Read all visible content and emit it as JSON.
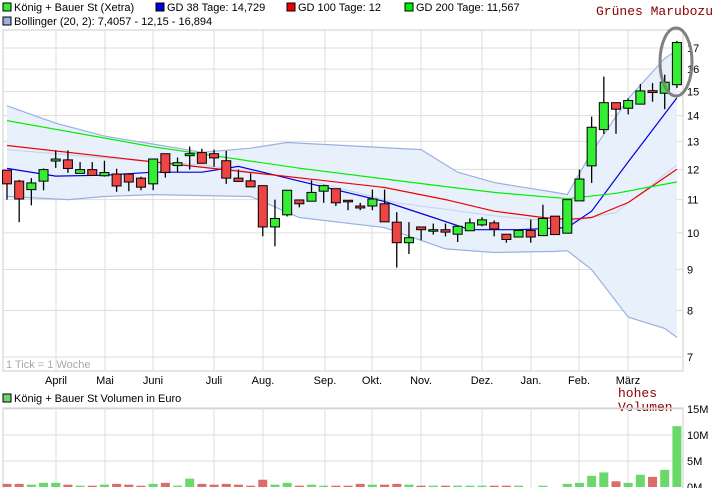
{
  "legend": {
    "items": [
      {
        "label": "König + Bauer St (Xetra)",
        "color": "#33ee33"
      },
      {
        "label": "GD 38 Tage: 14,729",
        "color": "#0000dd"
      },
      {
        "label": "GD 100 Tage: 12",
        "color": "#ee0000"
      },
      {
        "label": "GD 200 Tage: 11,567",
        "color": "#00ee00"
      },
      {
        "label": "Bollinger (20, 2): 7,4057 - 12,15 - 16,894",
        "color": "#9ab0e0"
      }
    ],
    "volume_label": "König + Bauer St Volumen in Euro",
    "volume_color": "#6ad86a"
  },
  "annotations": {
    "pattern": "Grünes Marubozu",
    "volume_note_1": "hohes",
    "volume_note_2": "Volumen",
    "tick_note": "1 Tick = 1 Woche",
    "highlight_color": "#808080",
    "note_color": "#8b0000"
  },
  "chart_data": [
    {
      "type": "candlestick",
      "yscale": "log",
      "ylim": [
        7,
        17.5
      ],
      "yticks": [
        "7",
        "8",
        "9",
        "10",
        "11",
        "12",
        "13",
        "14",
        "15",
        "16",
        "17"
      ],
      "x_tick_labels": [
        "April",
        "Mai",
        "Juni",
        "Juli",
        "Aug.",
        "Sep.",
        "Okt.",
        "Nov.",
        "Dez.",
        "Jan.",
        "Feb.",
        "März"
      ],
      "grid": true,
      "up_color": "#33ee33",
      "down_color": "#ee4444",
      "candles": [
        [
          11.97,
          11.97,
          11.0,
          11.51
        ],
        [
          11.6,
          11.64,
          10.31,
          11.02
        ],
        [
          11.32,
          11.7,
          10.82,
          11.54
        ],
        [
          11.6,
          12.03,
          11.3,
          11.99
        ],
        [
          12.29,
          12.67,
          12.05,
          12.36
        ],
        [
          12.33,
          12.67,
          11.88,
          12.03
        ],
        [
          11.86,
          12.25,
          11.86,
          11.99
        ],
        [
          11.99,
          12.25,
          11.79,
          11.79
        ],
        [
          11.78,
          12.3,
          11.75,
          11.89
        ],
        [
          11.84,
          12.02,
          11.25,
          11.44
        ],
        [
          11.84,
          11.84,
          11.27,
          11.57
        ],
        [
          11.7,
          11.75,
          11.3,
          11.4
        ],
        [
          11.51,
          12.36,
          11.3,
          12.36
        ],
        [
          12.55,
          12.55,
          11.72,
          11.89
        ],
        [
          12.13,
          12.41,
          11.91,
          12.23
        ],
        [
          12.48,
          12.81,
          11.99,
          12.55
        ],
        [
          12.59,
          12.73,
          12.21,
          12.21
        ],
        [
          12.55,
          12.7,
          12.09,
          12.4
        ],
        [
          12.3,
          12.65,
          11.51,
          11.7
        ],
        [
          11.7,
          11.99,
          11.59,
          11.59
        ],
        [
          11.61,
          11.86,
          11.41,
          11.41
        ],
        [
          11.45,
          11.45,
          9.9,
          10.17
        ],
        [
          10.17,
          11.0,
          9.62,
          10.42
        ],
        [
          10.53,
          11.3,
          10.48,
          11.3
        ],
        [
          10.99,
          10.99,
          10.76,
          10.87
        ],
        [
          10.95,
          11.63,
          10.95,
          11.23
        ],
        [
          11.27,
          11.48,
          10.9,
          11.45
        ],
        [
          11.35,
          11.35,
          10.8,
          10.9
        ],
        [
          10.98,
          10.98,
          10.67,
          10.93
        ],
        [
          10.8,
          10.9,
          10.67,
          10.74
        ],
        [
          10.8,
          11.32,
          10.67,
          11.02
        ],
        [
          10.87,
          11.32,
          10.32,
          10.32
        ],
        [
          10.31,
          10.61,
          9.05,
          9.72
        ],
        [
          9.72,
          10.31,
          9.41,
          9.86
        ],
        [
          10.17,
          10.17,
          9.79,
          10.09
        ],
        [
          10.09,
          10.27,
          9.95,
          10.09
        ],
        [
          10.09,
          10.27,
          9.9,
          10.02
        ],
        [
          9.96,
          10.19,
          9.74,
          10.19
        ],
        [
          10.06,
          10.42,
          10.06,
          10.29
        ],
        [
          10.23,
          10.46,
          10.19,
          10.38
        ],
        [
          10.29,
          10.36,
          9.9,
          10.11
        ],
        [
          9.96,
          9.96,
          9.72,
          9.81
        ],
        [
          9.88,
          10.07,
          9.88,
          10.07
        ],
        [
          10.07,
          10.39,
          9.72,
          9.88
        ],
        [
          9.92,
          10.84,
          9.92,
          10.42
        ],
        [
          10.49,
          10.49,
          9.95,
          9.95
        ],
        [
          9.99,
          11.0,
          9.99,
          11.0
        ],
        [
          10.96,
          11.99,
          10.96,
          11.67
        ],
        [
          12.12,
          13.96,
          11.54,
          13.54
        ],
        [
          13.45,
          15.66,
          13.28,
          14.53
        ],
        [
          14.53,
          14.53,
          13.29,
          14.26
        ],
        [
          14.3,
          14.71,
          14.05,
          14.62
        ],
        [
          14.47,
          15.33,
          14.47,
          15.03
        ],
        [
          15.04,
          15.37,
          14.57,
          14.96
        ],
        [
          14.93,
          15.75,
          14.26,
          15.41
        ],
        [
          15.3,
          17.35,
          15.15,
          17.27
        ]
      ],
      "candle_fields": [
        "open",
        "high",
        "low",
        "close"
      ],
      "lines": [
        {
          "name": "GD 38 Tage",
          "color": "#0000dd",
          "points": [
            [
              0,
              12.03
            ],
            [
              4,
              11.77
            ],
            [
              8,
              11.8
            ],
            [
              12,
              11.9
            ],
            [
              16,
              11.9
            ],
            [
              19,
              12.1
            ],
            [
              21,
              11.9
            ],
            [
              24,
              11.6
            ],
            [
              31,
              10.94
            ],
            [
              35,
              10.45
            ],
            [
              38,
              10.09
            ],
            [
              42,
              10.09
            ],
            [
              46,
              10.15
            ],
            [
              48,
              10.64
            ],
            [
              51,
              12.26
            ],
            [
              55,
              14.73
            ]
          ]
        },
        {
          "name": "GD 100 Tage",
          "color": "#ee0000",
          "points": [
            [
              0,
              12.85
            ],
            [
              12,
              12.26
            ],
            [
              24,
              11.71
            ],
            [
              31,
              11.39
            ],
            [
              36,
              11.0
            ],
            [
              40,
              10.64
            ],
            [
              44,
              10.45
            ],
            [
              46,
              10.39
            ],
            [
              48,
              10.45
            ],
            [
              51,
              10.91
            ],
            [
              55,
              12.0
            ]
          ]
        },
        {
          "name": "GD 200 Tage",
          "color": "#00ee00",
          "points": [
            [
              0,
              13.8
            ],
            [
              12,
              12.8
            ],
            [
              24,
              12.04
            ],
            [
              36,
              11.42
            ],
            [
              40,
              11.23
            ],
            [
              46,
              11.03
            ],
            [
              50,
              11.2
            ],
            [
              55,
              11.57
            ]
          ]
        }
      ],
      "bollinger": {
        "upper": [
          [
            0,
            14.4
          ],
          [
            4,
            13.7
          ],
          [
            8,
            13.2
          ],
          [
            12,
            12.9
          ],
          [
            16,
            12.6
          ],
          [
            20,
            12.75
          ],
          [
            23,
            12.96
          ],
          [
            34,
            12.7
          ],
          [
            37,
            11.9
          ],
          [
            40,
            11.55
          ],
          [
            45,
            11.23
          ],
          [
            46,
            11.16
          ],
          [
            48,
            12.6
          ],
          [
            51,
            14.7
          ],
          [
            54,
            16.5
          ],
          [
            55,
            16.894
          ]
        ],
        "middle": [
          [
            0,
            12.7
          ],
          [
            8,
            12.4
          ],
          [
            16,
            12.15
          ],
          [
            24,
            11.7
          ],
          [
            32,
            10.9
          ],
          [
            40,
            10.5
          ],
          [
            46,
            10.3
          ],
          [
            50,
            10.6
          ],
          [
            55,
            12.15
          ]
        ],
        "lower": [
          [
            0,
            11.1
          ],
          [
            5,
            11.0
          ],
          [
            8,
            11.1
          ],
          [
            12,
            11.16
          ],
          [
            20,
            11.1
          ],
          [
            24,
            10.45
          ],
          [
            31,
            10.15
          ],
          [
            36,
            9.55
          ],
          [
            40,
            9.45
          ],
          [
            45,
            9.48
          ],
          [
            46,
            9.5
          ],
          [
            48,
            9.0
          ],
          [
            51,
            7.85
          ],
          [
            54,
            7.6
          ],
          [
            55,
            7.4057
          ]
        ],
        "fill": "#e8f0fb",
        "line": "#9ab0e0"
      }
    },
    {
      "type": "bar",
      "ylabel": "Volumen in Euro",
      "ylim": [
        0,
        15000000
      ],
      "yticks": [
        "0M",
        "5M",
        "10M",
        "15M"
      ],
      "values": [
        0.6,
        0.6,
        0.45,
        0.8,
        0.8,
        0.45,
        0.25,
        0.25,
        0.45,
        0.6,
        0.45,
        0.25,
        0.6,
        0.8,
        0.25,
        1.6,
        0.6,
        0.45,
        0.6,
        0.45,
        0.25,
        1.4,
        0.45,
        0.8,
        0.25,
        0.45,
        0.25,
        0.25,
        0.25,
        0.6,
        0.45,
        0.45,
        0.6,
        0.45,
        0.25,
        0.25,
        0.25,
        0.25,
        0.25,
        0.25,
        0.25,
        0.25,
        0.25,
        0,
        0.25,
        0,
        0.6,
        0.8,
        2.15,
        2.8,
        1.1,
        0.8,
        2.35,
        1.95,
        3.3,
        11.7
      ],
      "unit": "M"
    }
  ]
}
